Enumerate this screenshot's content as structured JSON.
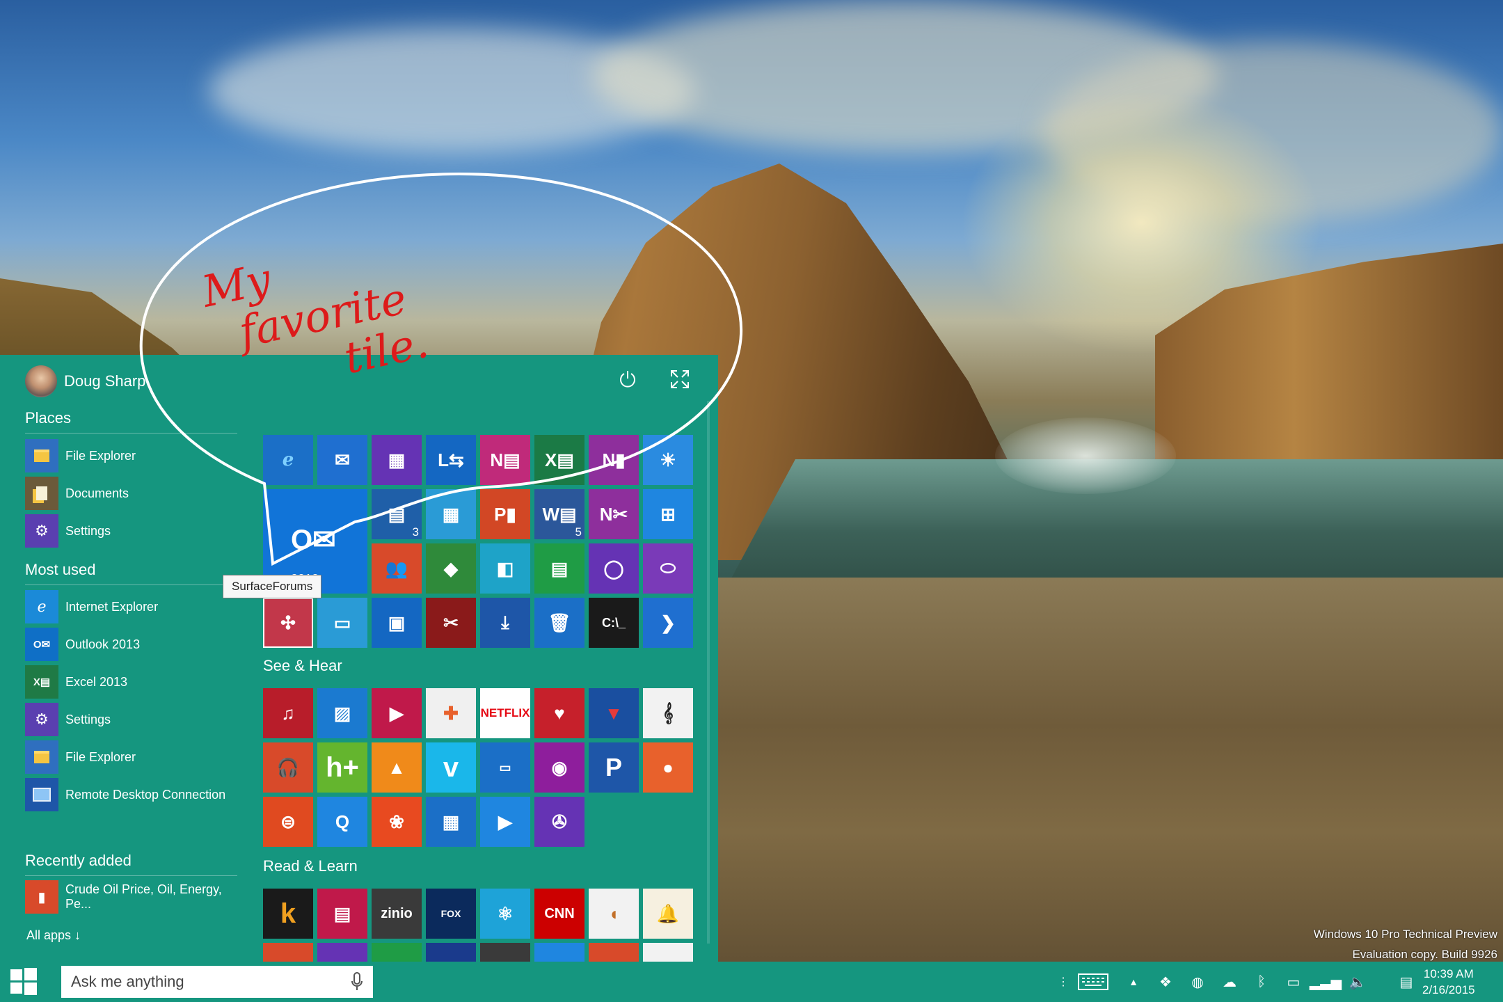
{
  "desktop": {
    "watermark_line1": "Windows 10 Pro Technical Preview",
    "watermark_line2": "Evaluation copy. Build 9926"
  },
  "start_menu": {
    "user_name": "Doug Sharp",
    "places_title": "Places",
    "places": [
      {
        "label": "File Explorer",
        "icon": "folder-icon",
        "color": "#2f6fbf"
      },
      {
        "label": "Documents",
        "icon": "documents-icon",
        "color": "#6b5a3a"
      },
      {
        "label": "Settings",
        "icon": "gear-icon",
        "color": "#5a3fb0"
      }
    ],
    "most_used_title": "Most used",
    "most_used": [
      {
        "label": "Internet Explorer",
        "icon": "ie-icon",
        "color": "#1b8ad8"
      },
      {
        "label": "Outlook 2013",
        "icon": "outlook-icon",
        "color": "#0f6fc6"
      },
      {
        "label": "Excel 2013",
        "icon": "excel-icon",
        "color": "#1f7a45"
      },
      {
        "label": "Settings",
        "icon": "gear-icon",
        "color": "#5a3fb0"
      },
      {
        "label": "File Explorer",
        "icon": "folder-icon",
        "color": "#2f6fbf"
      },
      {
        "label": "Remote Desktop Connection",
        "icon": "remote-desktop-icon",
        "color": "#1e56a8"
      }
    ],
    "recently_added_title": "Recently added",
    "recently_added": [
      {
        "label": "Crude Oil Price, Oil, Energy, Pe...",
        "icon": "news-icon",
        "color": "#d84a2a"
      }
    ],
    "all_apps_label": "All apps ↓",
    "see_hear_title": "See & Hear",
    "read_learn_title": "Read & Learn",
    "big_tile_label": "2013",
    "big_tile_glyph": "O✉",
    "tooltip": "SurfaceForums"
  },
  "annotation": {
    "line1": "My",
    "line2": "favorite",
    "line3": "tile."
  },
  "taskbar": {
    "search_placeholder": "Ask me anything",
    "time": "10:39 AM",
    "date": "2/16/2015"
  }
}
